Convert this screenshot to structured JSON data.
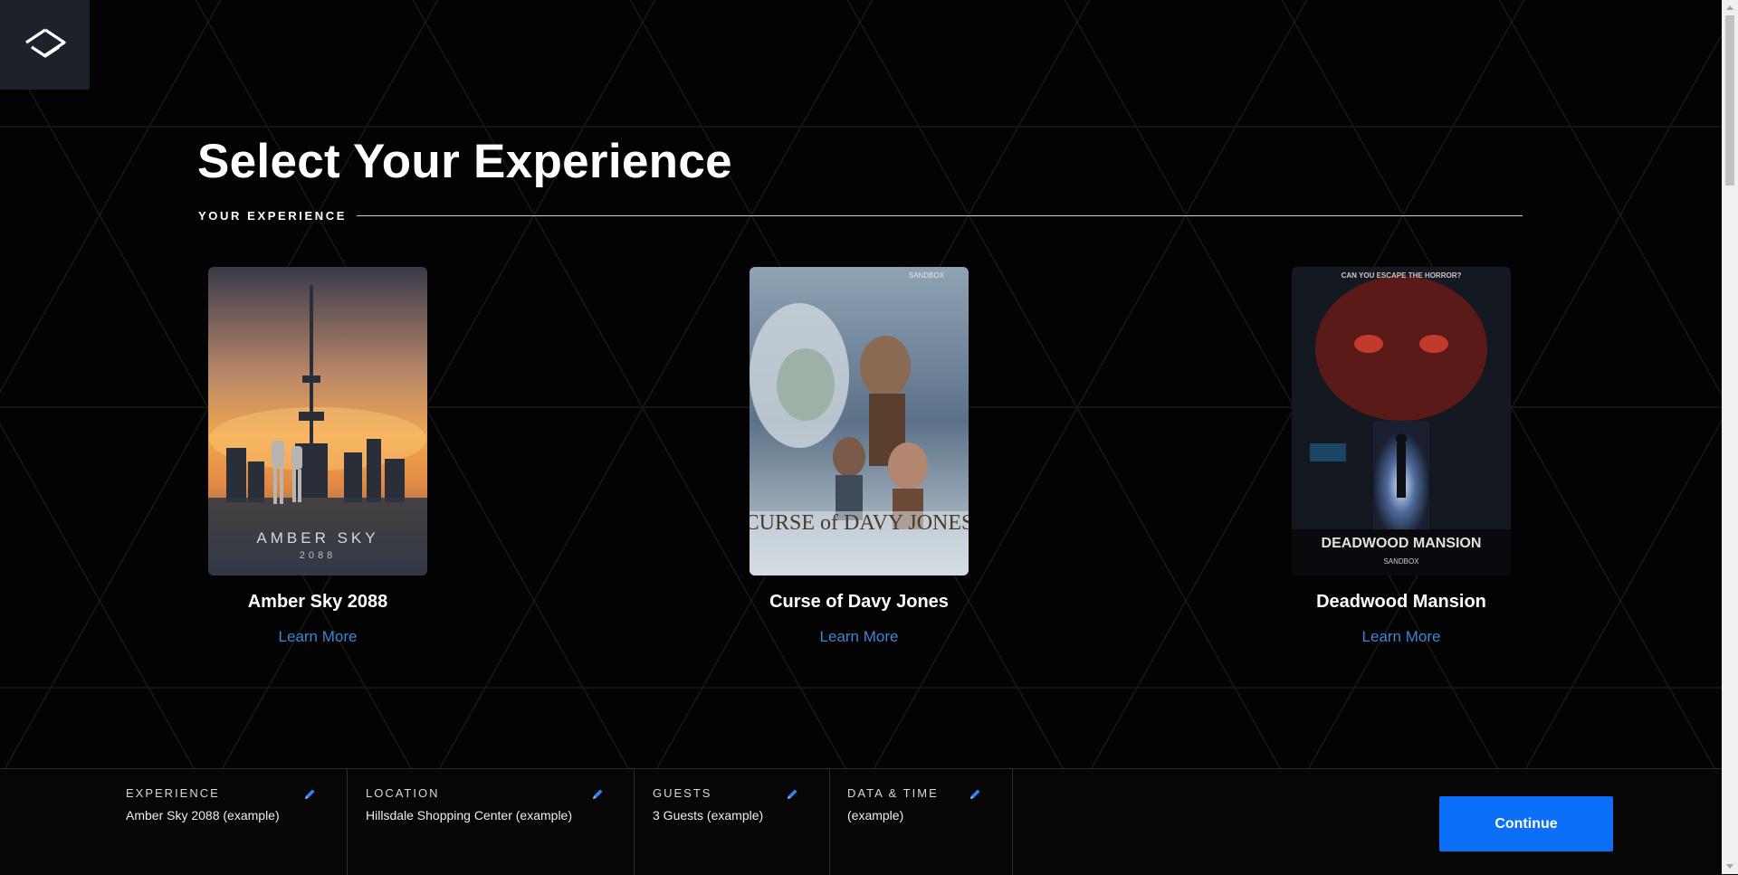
{
  "page": {
    "title": "Select Your Experience",
    "section_label": "YOUR EXPERIENCE"
  },
  "experiences": [
    {
      "title": "Amber Sky 2088",
      "link": "Learn More",
      "poster_text": "AMBER SKY",
      "poster_subtext": "2088"
    },
    {
      "title": "Curse of Davy Jones",
      "link": "Learn More",
      "poster_text": "CURSE of DAVY JONES",
      "poster_brand": "SANDBOX"
    },
    {
      "title": "Deadwood Mansion",
      "link": "Learn More",
      "poster_tagline": "CAN YOU ESCAPE THE HORROR?",
      "poster_text": "DEADWOOD MANSION",
      "poster_brand": "SANDBOX"
    }
  ],
  "summary": {
    "experience": {
      "label": "EXPERIENCE",
      "value": "Amber Sky 2088 (example)"
    },
    "location": {
      "label": "LOCATION",
      "value": "Hillsdale Shopping Center (example)"
    },
    "guests": {
      "label": "GUESTS",
      "value": "3 Guests (example)"
    },
    "datetime": {
      "label": "DATA & TIME",
      "value": "(example)"
    }
  },
  "actions": {
    "continue_label": "Continue"
  },
  "icons": {
    "logo": "sandbox-logo-icon",
    "edit": "pencil-icon"
  },
  "colors": {
    "accent": "#0c6ff7",
    "link": "#3f84d6",
    "background": "#030303",
    "logo_bg": "#1d222a"
  }
}
